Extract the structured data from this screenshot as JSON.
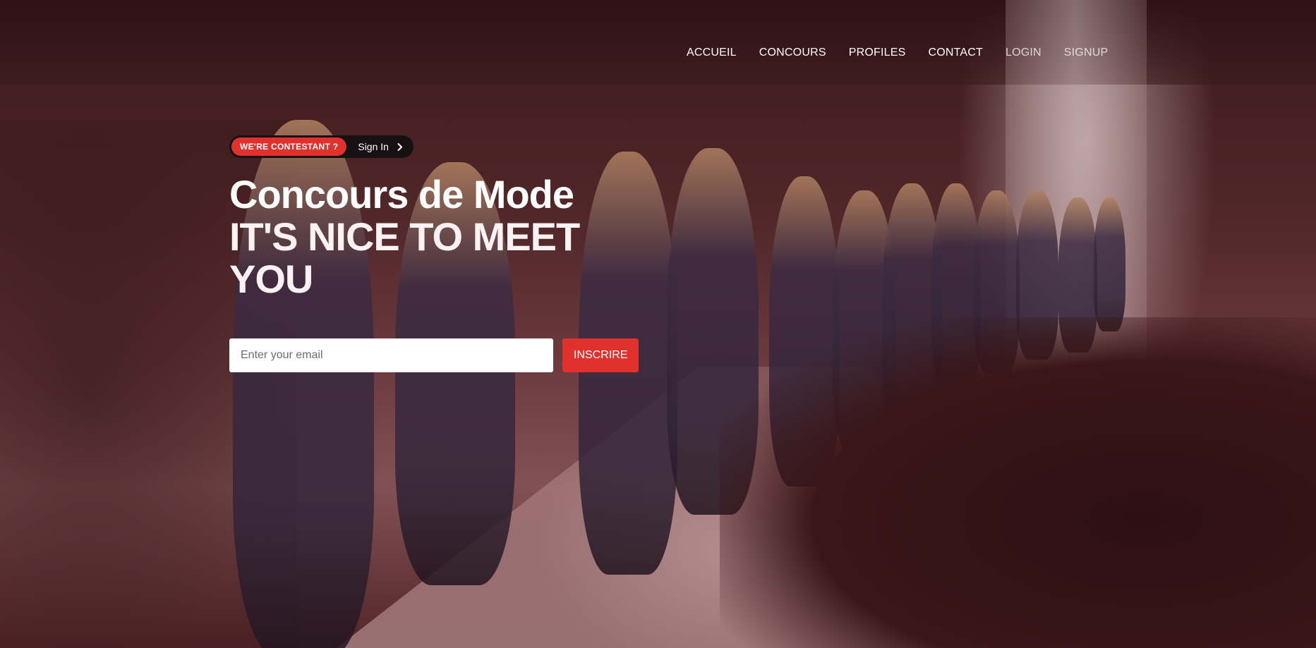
{
  "nav": {
    "items": [
      {
        "label": "ACCUEIL"
      },
      {
        "label": "CONCOURS"
      },
      {
        "label": "PROFILES"
      },
      {
        "label": "CONTACT"
      },
      {
        "label": "LOGIN"
      },
      {
        "label": "SIGNUP"
      }
    ]
  },
  "hero": {
    "badge": "WE'RE CONTESTANT ?",
    "signin_link": "Sign In",
    "title_line1": "Concours de Mode",
    "title_line2": "IT'S NICE TO MEET YOU",
    "email_placeholder": "Enter your email",
    "submit_label": "INSCRIRE",
    "background_image": "fashion-runway-photo"
  },
  "colors": {
    "accent": "#e0312c",
    "pill_bg": "#161012",
    "text": "#ffffff"
  },
  "icons": {
    "signin_arrow": "chevron-right-icon"
  }
}
